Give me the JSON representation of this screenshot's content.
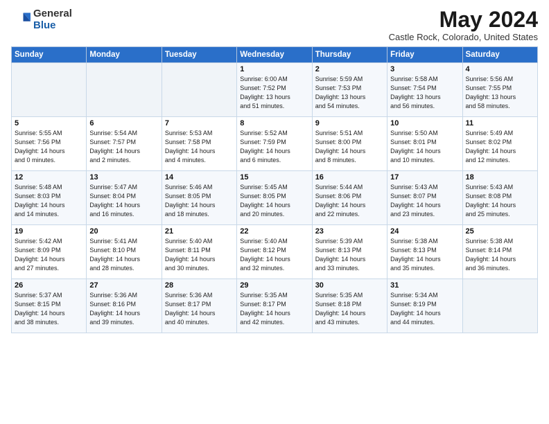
{
  "logo": {
    "general": "General",
    "blue": "Blue"
  },
  "header": {
    "month": "May 2024",
    "location": "Castle Rock, Colorado, United States"
  },
  "weekdays": [
    "Sunday",
    "Monday",
    "Tuesday",
    "Wednesday",
    "Thursday",
    "Friday",
    "Saturday"
  ],
  "weeks": [
    [
      {
        "day": "",
        "info": ""
      },
      {
        "day": "",
        "info": ""
      },
      {
        "day": "",
        "info": ""
      },
      {
        "day": "1",
        "info": "Sunrise: 6:00 AM\nSunset: 7:52 PM\nDaylight: 13 hours\nand 51 minutes."
      },
      {
        "day": "2",
        "info": "Sunrise: 5:59 AM\nSunset: 7:53 PM\nDaylight: 13 hours\nand 54 minutes."
      },
      {
        "day": "3",
        "info": "Sunrise: 5:58 AM\nSunset: 7:54 PM\nDaylight: 13 hours\nand 56 minutes."
      },
      {
        "day": "4",
        "info": "Sunrise: 5:56 AM\nSunset: 7:55 PM\nDaylight: 13 hours\nand 58 minutes."
      }
    ],
    [
      {
        "day": "5",
        "info": "Sunrise: 5:55 AM\nSunset: 7:56 PM\nDaylight: 14 hours\nand 0 minutes."
      },
      {
        "day": "6",
        "info": "Sunrise: 5:54 AM\nSunset: 7:57 PM\nDaylight: 14 hours\nand 2 minutes."
      },
      {
        "day": "7",
        "info": "Sunrise: 5:53 AM\nSunset: 7:58 PM\nDaylight: 14 hours\nand 4 minutes."
      },
      {
        "day": "8",
        "info": "Sunrise: 5:52 AM\nSunset: 7:59 PM\nDaylight: 14 hours\nand 6 minutes."
      },
      {
        "day": "9",
        "info": "Sunrise: 5:51 AM\nSunset: 8:00 PM\nDaylight: 14 hours\nand 8 minutes."
      },
      {
        "day": "10",
        "info": "Sunrise: 5:50 AM\nSunset: 8:01 PM\nDaylight: 14 hours\nand 10 minutes."
      },
      {
        "day": "11",
        "info": "Sunrise: 5:49 AM\nSunset: 8:02 PM\nDaylight: 14 hours\nand 12 minutes."
      }
    ],
    [
      {
        "day": "12",
        "info": "Sunrise: 5:48 AM\nSunset: 8:03 PM\nDaylight: 14 hours\nand 14 minutes."
      },
      {
        "day": "13",
        "info": "Sunrise: 5:47 AM\nSunset: 8:04 PM\nDaylight: 14 hours\nand 16 minutes."
      },
      {
        "day": "14",
        "info": "Sunrise: 5:46 AM\nSunset: 8:05 PM\nDaylight: 14 hours\nand 18 minutes."
      },
      {
        "day": "15",
        "info": "Sunrise: 5:45 AM\nSunset: 8:05 PM\nDaylight: 14 hours\nand 20 minutes."
      },
      {
        "day": "16",
        "info": "Sunrise: 5:44 AM\nSunset: 8:06 PM\nDaylight: 14 hours\nand 22 minutes."
      },
      {
        "day": "17",
        "info": "Sunrise: 5:43 AM\nSunset: 8:07 PM\nDaylight: 14 hours\nand 23 minutes."
      },
      {
        "day": "18",
        "info": "Sunrise: 5:43 AM\nSunset: 8:08 PM\nDaylight: 14 hours\nand 25 minutes."
      }
    ],
    [
      {
        "day": "19",
        "info": "Sunrise: 5:42 AM\nSunset: 8:09 PM\nDaylight: 14 hours\nand 27 minutes."
      },
      {
        "day": "20",
        "info": "Sunrise: 5:41 AM\nSunset: 8:10 PM\nDaylight: 14 hours\nand 28 minutes."
      },
      {
        "day": "21",
        "info": "Sunrise: 5:40 AM\nSunset: 8:11 PM\nDaylight: 14 hours\nand 30 minutes."
      },
      {
        "day": "22",
        "info": "Sunrise: 5:40 AM\nSunset: 8:12 PM\nDaylight: 14 hours\nand 32 minutes."
      },
      {
        "day": "23",
        "info": "Sunrise: 5:39 AM\nSunset: 8:13 PM\nDaylight: 14 hours\nand 33 minutes."
      },
      {
        "day": "24",
        "info": "Sunrise: 5:38 AM\nSunset: 8:13 PM\nDaylight: 14 hours\nand 35 minutes."
      },
      {
        "day": "25",
        "info": "Sunrise: 5:38 AM\nSunset: 8:14 PM\nDaylight: 14 hours\nand 36 minutes."
      }
    ],
    [
      {
        "day": "26",
        "info": "Sunrise: 5:37 AM\nSunset: 8:15 PM\nDaylight: 14 hours\nand 38 minutes."
      },
      {
        "day": "27",
        "info": "Sunrise: 5:36 AM\nSunset: 8:16 PM\nDaylight: 14 hours\nand 39 minutes."
      },
      {
        "day": "28",
        "info": "Sunrise: 5:36 AM\nSunset: 8:17 PM\nDaylight: 14 hours\nand 40 minutes."
      },
      {
        "day": "29",
        "info": "Sunrise: 5:35 AM\nSunset: 8:17 PM\nDaylight: 14 hours\nand 42 minutes."
      },
      {
        "day": "30",
        "info": "Sunrise: 5:35 AM\nSunset: 8:18 PM\nDaylight: 14 hours\nand 43 minutes."
      },
      {
        "day": "31",
        "info": "Sunrise: 5:34 AM\nSunset: 8:19 PM\nDaylight: 14 hours\nand 44 minutes."
      },
      {
        "day": "",
        "info": ""
      }
    ]
  ]
}
